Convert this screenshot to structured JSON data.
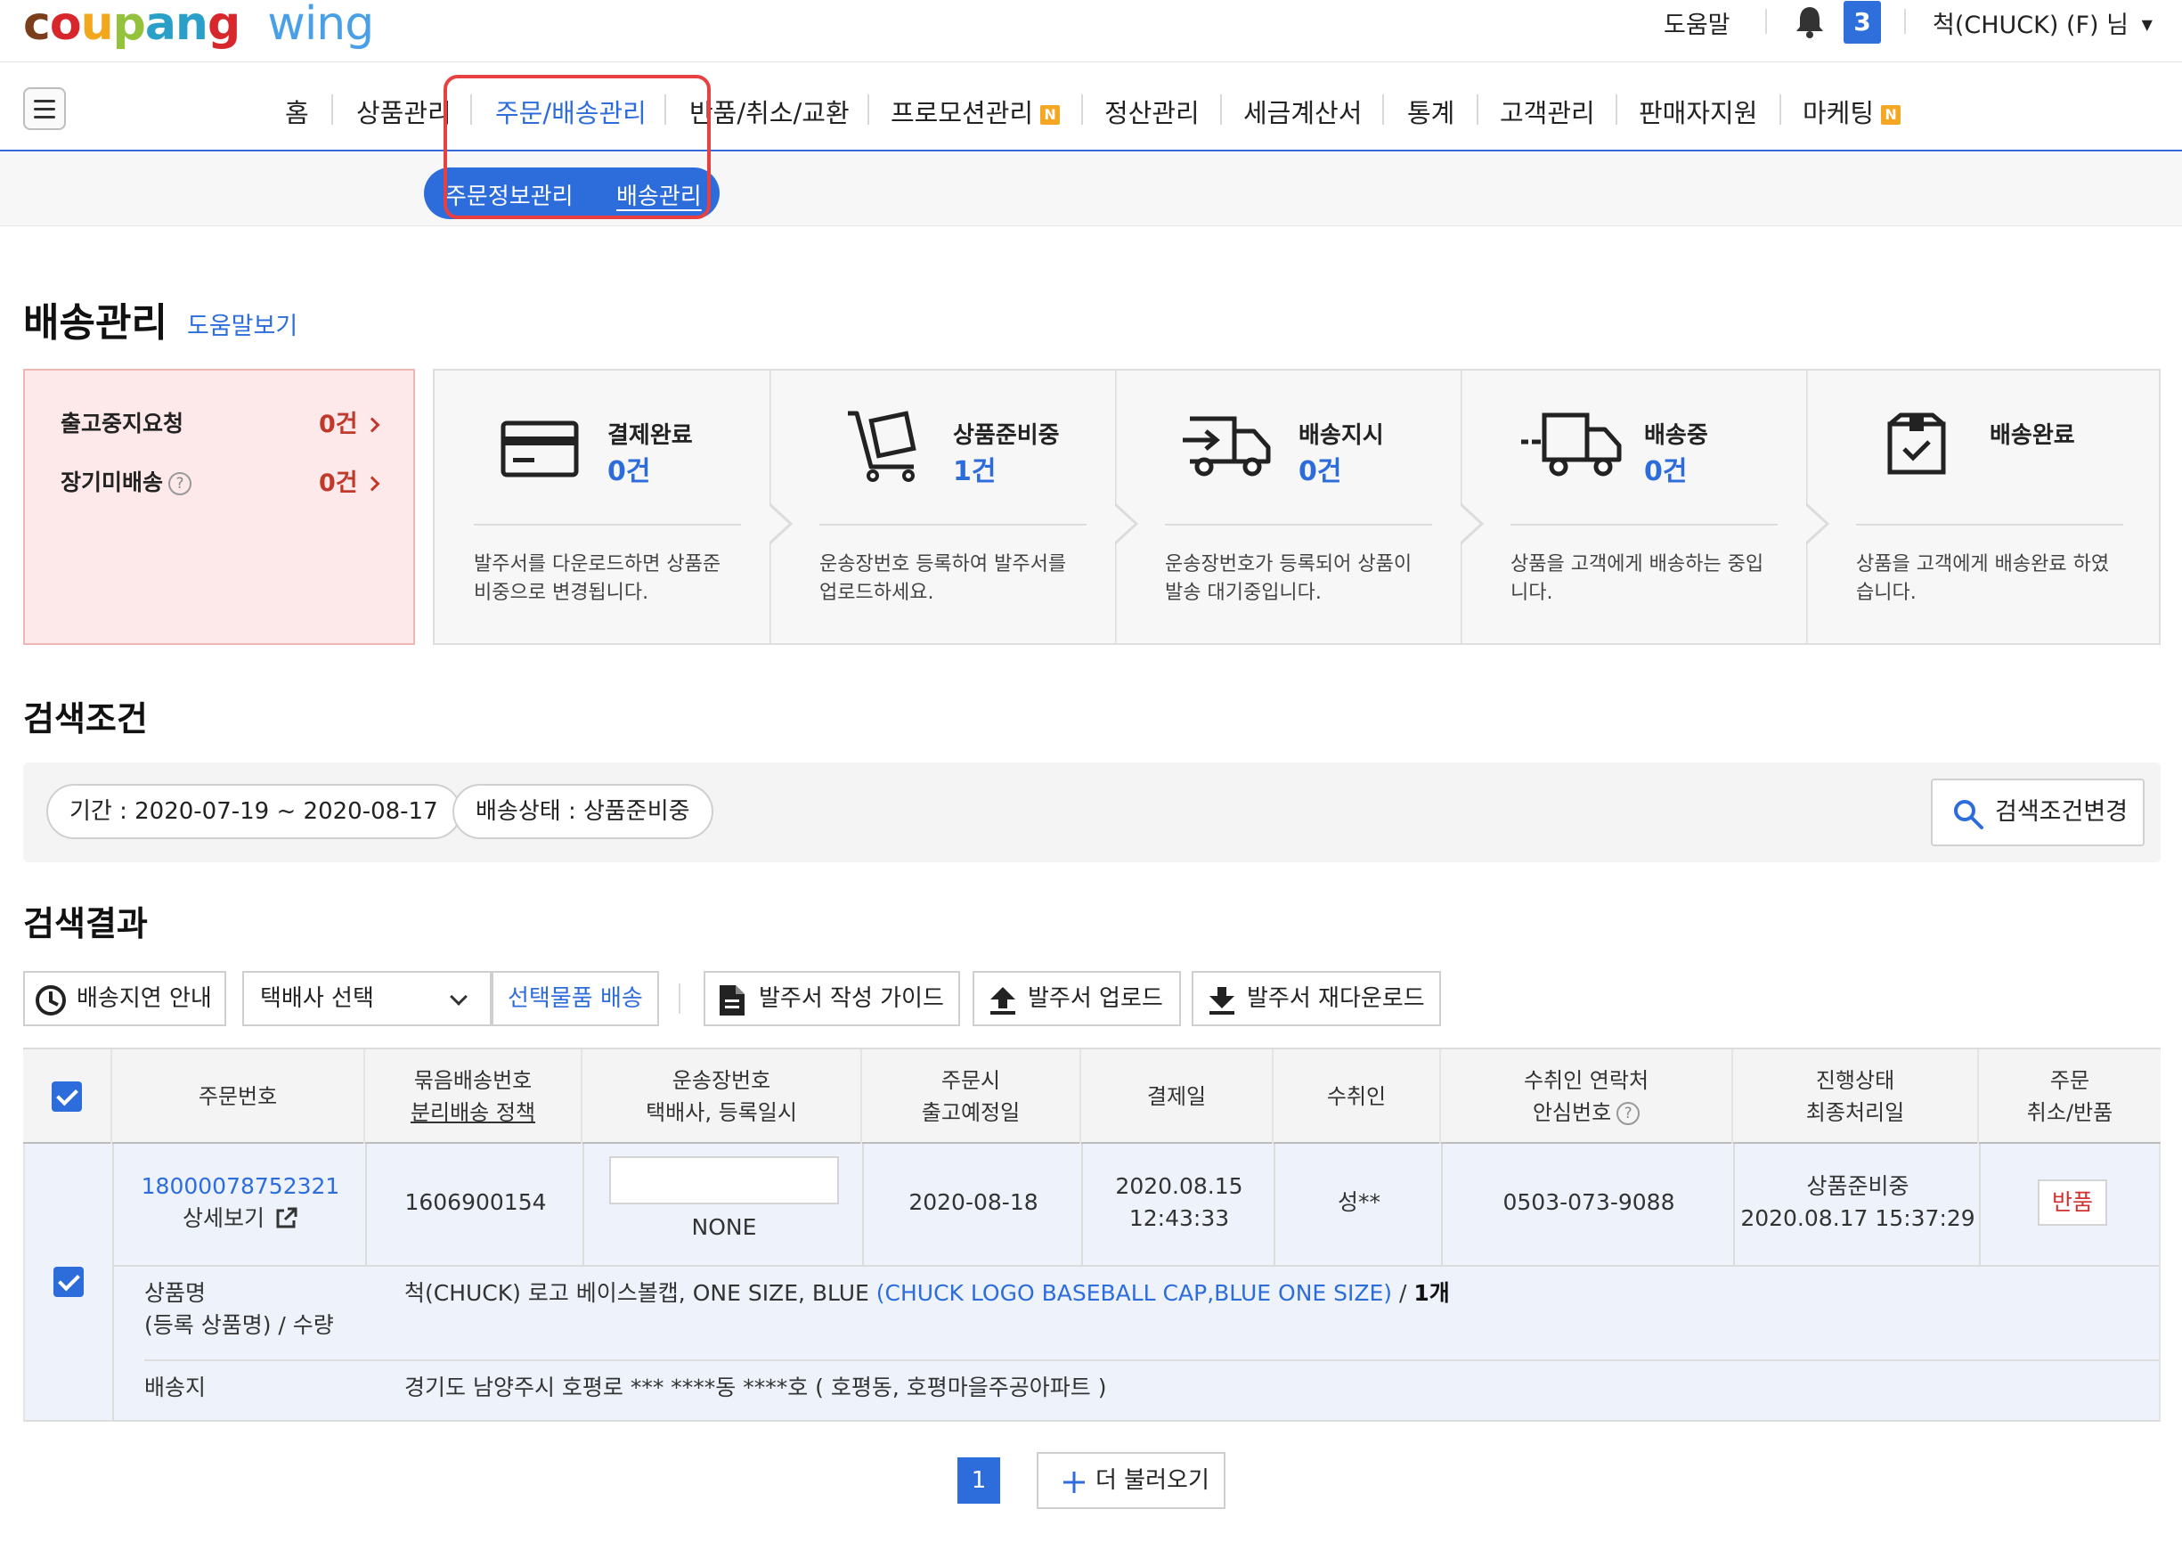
{
  "header": {
    "logo_main": "coupang",
    "logo_sub": "wing",
    "help": "도움말",
    "notification_count": "3",
    "user": "척(CHUCK) (F) 님"
  },
  "gnb": {
    "items": [
      {
        "label": "홈"
      },
      {
        "label": "상품관리"
      },
      {
        "label": "주문/배송관리"
      },
      {
        "label": "반품/취소/교환"
      },
      {
        "label": "프로모션관리",
        "badge": "N"
      },
      {
        "label": "정산관리"
      },
      {
        "label": "세금계산서"
      },
      {
        "label": "통계"
      },
      {
        "label": "고객관리"
      },
      {
        "label": "판매자지원"
      },
      {
        "label": "마케팅",
        "badge": "N"
      }
    ]
  },
  "subnav": {
    "items": [
      {
        "label": "주문정보관리"
      },
      {
        "label": "배송관리"
      }
    ]
  },
  "page": {
    "title": "배송관리",
    "help_link": "도움말보기"
  },
  "alerts": {
    "items": [
      {
        "label": "출고중지요청",
        "count": "0건"
      },
      {
        "label": "장기미배송",
        "count": "0건"
      }
    ]
  },
  "status": {
    "steps": [
      {
        "title": "결제완료",
        "count": "0건",
        "desc_line1": "발주서를 다운로드하면 상품준",
        "desc_line2": "비중으로 변경됩니다.",
        "icon": "credit-card-icon"
      },
      {
        "title": "상품준비중",
        "count": "1건",
        "desc_line1": "운송장번호 등록하여 발주서를",
        "desc_line2": "업로드하세요.",
        "icon": "cart-box-icon"
      },
      {
        "title": "배송지시",
        "count": "0건",
        "desc_line1": "운송장번호가 등록되어 상품이",
        "desc_line2": "발송 대기중입니다.",
        "icon": "truck-arrow-icon"
      },
      {
        "title": "배송중",
        "count": "0건",
        "desc_line1": "상품을 고객에게 배송하는 중입",
        "desc_line2": "니다.",
        "icon": "truck-moving-icon"
      },
      {
        "title": "배송완료",
        "count": "",
        "desc_line1": "상품을 고객에게 배송완료 하였",
        "desc_line2": "습니다.",
        "icon": "box-check-icon"
      }
    ]
  },
  "search": {
    "section_title": "검색조건",
    "chips": [
      {
        "label": "기간 : 2020-07-19 ~ 2020-08-17"
      },
      {
        "label": "배송상태 : 상품준비중"
      }
    ],
    "change_button": "검색조건변경"
  },
  "results": {
    "section_title": "검색결과",
    "toolbar": {
      "delay_notice": "배송지연 안내",
      "courier_select": "택배사 선택",
      "ship_selected": "선택물품 배송",
      "guide": "발주서 작성 가이드",
      "upload": "발주서 업로드",
      "redownload": "발주서 재다운로드"
    },
    "columns": {
      "order_no": "주문번호",
      "bundle_line1": "묶음배송번호",
      "bundle_line2": "분리배송 정책",
      "tracking_line1": "운송장번호",
      "tracking_line2": "택배사, 등록일시",
      "ship_line1": "주문시",
      "ship_line2": "출고예정일",
      "paid_date": "결제일",
      "recipient": "수취인",
      "contact_line1": "수취인 연락처",
      "contact_line2": "안심번호",
      "status_line1": "진행상태",
      "status_line2": "최종처리일",
      "cancel_line1": "주문",
      "cancel_line2": "취소/반품"
    },
    "row": {
      "order_no": "18000078752321",
      "detail_link": "상세보기",
      "bundle_no": "1606900154",
      "tracking_input": "",
      "courier": "NONE",
      "ship_date": "2020-08-18",
      "paid_date": "2020.08.15",
      "paid_time": "12:43:33",
      "recipient": "성**",
      "contact": "0503-073-9088",
      "status": "상품준비중",
      "status_date": "2020.08.17 15:37:29",
      "return_button": "반품",
      "product_label_line1": "상품명",
      "product_label_line2": "(등록 상품명) / 수량",
      "product_name": "척(CHUCK) 로고 베이스볼캡, ONE SIZE, BLUE",
      "product_registered": "(CHUCK LOGO BASEBALL CAP,BLUE ONE SIZE)",
      "product_sep": "/",
      "product_qty": "1개",
      "address_label": "배송지",
      "address": "경기도 남양주시 호평로 *** ****동 ****호 ( 호평동, 호평마을주공아파트 )"
    }
  },
  "pagination": {
    "current_page": "1",
    "load_more": "더 불러오기"
  },
  "colors": {
    "brand_blue": "#2d6ddb",
    "alert_red": "#c0392b",
    "highlight_box": "#e84040"
  }
}
